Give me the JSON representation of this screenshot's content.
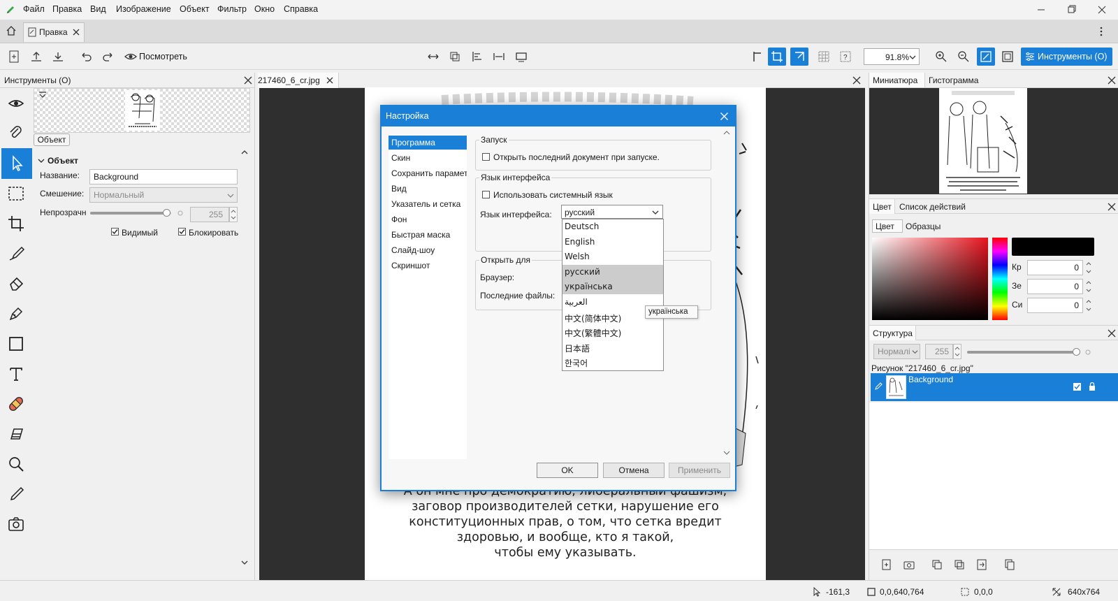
{
  "menu": {
    "items": [
      "Файл",
      "Правка",
      "Вид",
      "Изображение",
      "Объект",
      "Фильтр",
      "Окно",
      "Справка"
    ]
  },
  "tabs": {
    "doc_tab": "Правка"
  },
  "toolbar": {
    "view_label": "Посмотреть",
    "zoom_value": "91.8%",
    "tools_button": "Инструменты (О)"
  },
  "left_panel": {
    "title": "Инструменты (О)",
    "object_button": "Объект",
    "section_title": "Объект",
    "name_label": "Название:",
    "name_value": "Background",
    "blend_label": "Смешение:",
    "blend_value": "Нормальный",
    "opacity_label": "Непрозрачн",
    "opacity_value": "255",
    "opacity_level": 0.95,
    "visible_label": "Видимый",
    "lock_label": "Блокировать"
  },
  "canvas": {
    "tab_title": "217460_6_cr.jpg",
    "caption_lines": [
      "А он мне про демократию, либеральный фашизм,",
      "заговор производителей сетки, нарушение его",
      "конституционных прав, о том, что сетка вредит",
      "здоровью, и вообще, кто я такой,",
      "чтобы ему указывать."
    ]
  },
  "dialog": {
    "title": "Настройка",
    "nav": [
      "Программа",
      "Скин",
      "Сохранить парамет",
      "Вид",
      "Указатель и сетка",
      "Фон",
      "Быстрая маска",
      "Слайд-шоу",
      "Скриншот"
    ],
    "startup_group": "Запуск",
    "startup_checkbox": "Открыть последний документ при запуске.",
    "lang_group": "Язык интерфейса",
    "system_lang_checkbox": "Использовать системный язык",
    "lang_label": "Язык интерфейса:",
    "lang_selected": "русский",
    "lang_options": [
      "Deutsch",
      "English",
      "Welsh",
      "русский",
      "українська",
      "العربية",
      "中文(简体中文)",
      "中文(繁體中文)",
      "日本語",
      "한국어"
    ],
    "open_group": "Открыть для",
    "browser_label": "Браузер:",
    "recent_label": "Последние файлы:",
    "ok": "OK",
    "cancel": "Отмена",
    "apply": "Применить",
    "tooltip": "українська"
  },
  "right_panel": {
    "tab_thumbnail": "Миниатюра",
    "tab_histogram": "Гистограмма",
    "tab_color": "Цвет",
    "tab_actions": "Список действий",
    "sub_color": "Цвет",
    "sub_swatches": "Образцы",
    "r_label": "Кр",
    "g_label": "Зе",
    "b_label": "Си",
    "r_value": "0",
    "g_value": "0",
    "b_value": "0",
    "structure_title": "Структура",
    "layer_blend": "Нормалі",
    "layer_opacity": "255",
    "image_label": "Рисунок \"217460_6_cr.jpg\"",
    "layer_name": "Background"
  },
  "status": {
    "cursor": "-161,3",
    "selection_rect": "0,0,640,764",
    "selection_size": "0,0,0",
    "image_size": "640x764"
  },
  "colors": {
    "accent": "#1a7fd6",
    "canvas_bg": "#2f2f2f"
  }
}
